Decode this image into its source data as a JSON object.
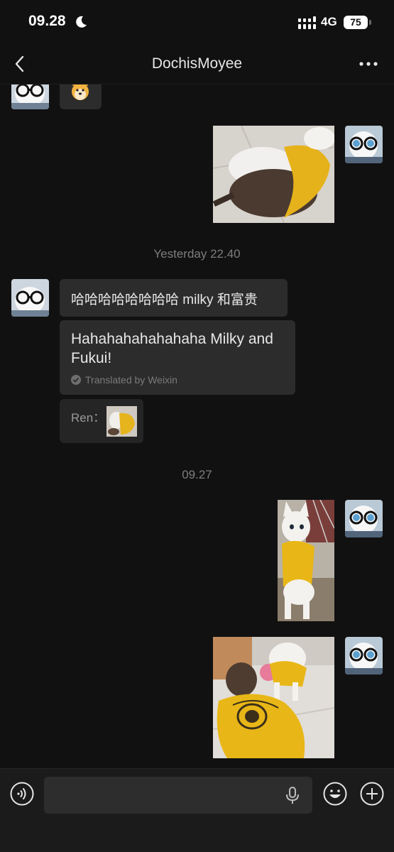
{
  "status_bar": {
    "time": "09.28",
    "network": "4G",
    "battery": "75"
  },
  "header": {
    "title": "DochisMoyee"
  },
  "messages": {
    "timestamp_1": "Yesterday 22.40",
    "incoming_text": "哈哈哈哈哈哈哈哈 milky 和富贵",
    "translation_text": "Hahahahahahahaha Milky and Fukui!",
    "translation_note": "Translated by Weixin",
    "quote_sender": "Ren：",
    "timestamp_2": "09.27"
  },
  "colors": {
    "background": "#111111",
    "bubble": "#2c2c2c",
    "input_bar": "#1b1b1b",
    "cat_shirt_yellow": "#e9b81a"
  },
  "icons": {
    "back": "chevron-left-icon",
    "more": "ellipsis-icon",
    "voice": "voice-icon",
    "mic": "microphone-icon",
    "emoji": "smiley-icon",
    "plus": "plus-icon"
  }
}
